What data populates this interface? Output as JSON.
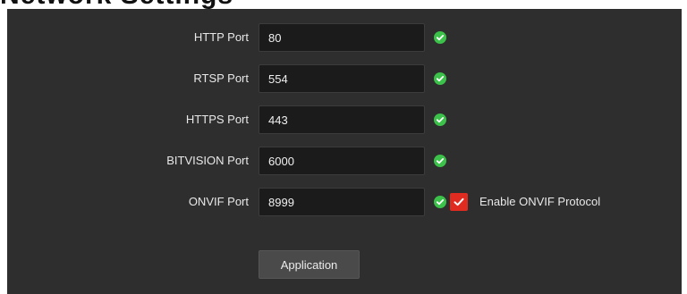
{
  "header": {
    "partial_title": "Network Settings"
  },
  "ports": [
    {
      "label": "HTTP Port",
      "value": "80"
    },
    {
      "label": "RTSP Port",
      "value": "554"
    },
    {
      "label": "HTTPS Port",
      "value": "443"
    },
    {
      "label": "BITVISION Port",
      "value": "6000"
    },
    {
      "label": "ONVIF Port",
      "value": "8999"
    }
  ],
  "onvif": {
    "enable_label": "Enable ONVIF Protocol",
    "enabled": true
  },
  "actions": {
    "apply_label": "Application"
  },
  "icons": {
    "status": "check-circle-icon",
    "checkbox": "checkmark-icon"
  },
  "colors": {
    "panel_bg": "#2e2e2e",
    "field_bg": "#1b1b1b",
    "status_ok": "#3cc24a",
    "checkbox_on": "#e02b20",
    "button_bg": "#4a4a4a"
  }
}
